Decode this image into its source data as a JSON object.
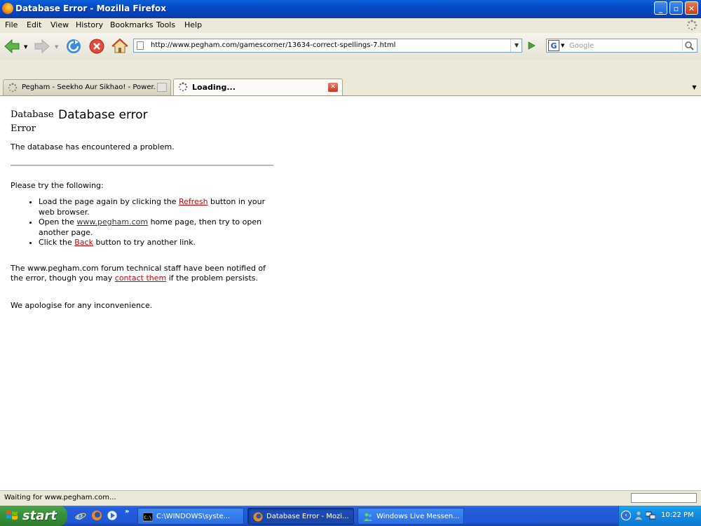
{
  "window": {
    "title": "Database Error - Mozilla Firefox",
    "controls": {
      "minimize": "_",
      "maximize": "▫",
      "close": "✕"
    }
  },
  "menu": [
    "File",
    "Edit",
    "View",
    "History",
    "Bookmarks",
    "Tools",
    "Help"
  ],
  "toolbar": {
    "url": "http://www.pegham.com/gamescorner/13634-correct-spellings-7.html",
    "search_placeholder": "Google",
    "search_engine_letter": "G"
  },
  "tabs": [
    {
      "label": "Pegham - Seekho Aur Sikhao! - Power...",
      "active": false
    },
    {
      "label": "Loading...",
      "active": true
    }
  ],
  "page": {
    "logo_alt": "Database Error",
    "title": "Database error",
    "intro": "The database has encountered a problem.",
    "try_heading": "Please try the following:",
    "suggestions": [
      {
        "before": "Load the page again by clicking the ",
        "link": "Refresh",
        "after": " button in your web browser."
      },
      {
        "before": "Open the ",
        "link": "www.pegham.com",
        "after": " home page, then try to open another page."
      },
      {
        "before": "Click the ",
        "link": "Back",
        "after": " button to try another link."
      }
    ],
    "notified": {
      "before": "The www.pegham.com forum technical staff have been notified of the error, though you may ",
      "link": "contact them",
      "after": " if the problem persists."
    },
    "apologise": "We apologise for any inconvenience."
  },
  "status": {
    "text": "Waiting for www.pegham.com..."
  },
  "taskbar": {
    "start_label": "start",
    "more": "»",
    "tasks": [
      {
        "label": "C:\\WINDOWS\\syste...",
        "active": false
      },
      {
        "label": "Database Error - Mozi...",
        "active": true
      },
      {
        "label": "Windows Live Messen...",
        "active": false
      }
    ],
    "clock": "10:22 PM"
  },
  "colors": {
    "titlebar": "#0a55d0",
    "link": "#cc0000",
    "chrome": "#ece9d8",
    "taskbar": "#245edb",
    "start": "#37933a"
  }
}
